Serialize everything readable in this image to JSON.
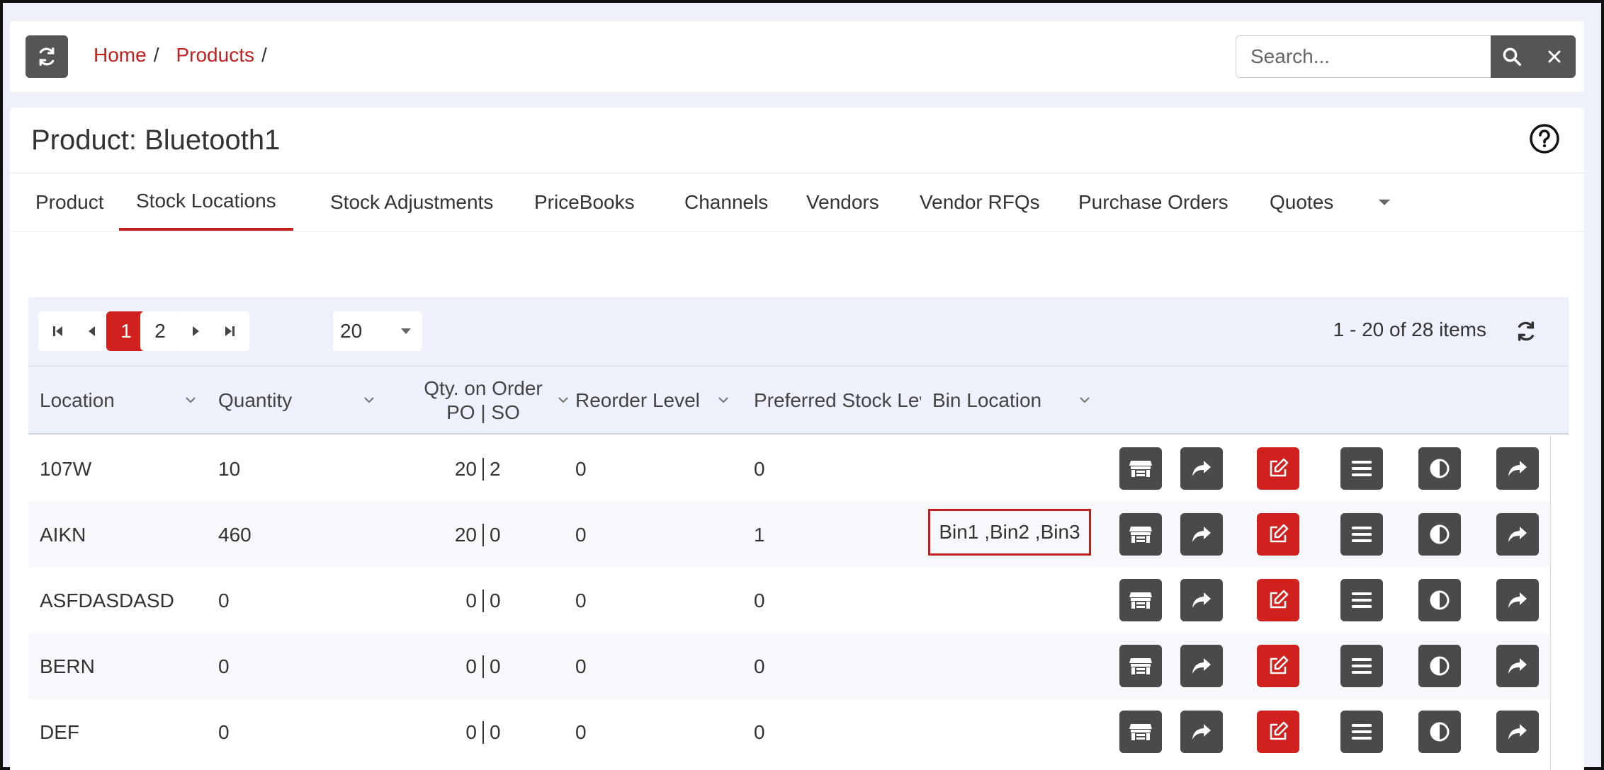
{
  "topbar": {
    "breadcrumb": [
      "Home",
      "Products"
    ],
    "separator": "/",
    "search_placeholder": "Search..."
  },
  "page": {
    "title": "Product: Bluetooth1"
  },
  "tabs": [
    {
      "label": "Product"
    },
    {
      "label": "Stock Locations",
      "active": true
    },
    {
      "label": "Stock Adjustments"
    },
    {
      "label": "PriceBooks"
    },
    {
      "label": "Channels"
    },
    {
      "label": "Vendors"
    },
    {
      "label": "Vendor RFQs"
    },
    {
      "label": "Purchase Orders"
    },
    {
      "label": "Quotes"
    }
  ],
  "pager": {
    "pages": [
      "1",
      "2"
    ],
    "current_page": "1",
    "page_size": "20",
    "info": "1 - 20 of 28 items"
  },
  "columns": {
    "location": "Location",
    "quantity": "Quantity",
    "qty_on_order_line1": "Qty. on Order",
    "qty_on_order_line2": "PO | SO",
    "reorder_level": "Reorder Level",
    "preferred_stock": "Preferred Stock Level",
    "bin_location": "Bin Location"
  },
  "rows": [
    {
      "location": "107W",
      "quantity": "10",
      "po": "20",
      "so": "2",
      "reorder": "0",
      "preferred": "0",
      "bin": ""
    },
    {
      "location": "AIKN",
      "quantity": "460",
      "po": "20",
      "so": "0",
      "reorder": "0",
      "preferred": "1",
      "bin": "Bin1 ,Bin2 ,Bin3"
    },
    {
      "location": "ASFDASDASD",
      "quantity": "0",
      "po": "0",
      "so": "0",
      "reorder": "0",
      "preferred": "0",
      "bin": ""
    },
    {
      "location": "BERN",
      "quantity": "0",
      "po": "0",
      "so": "0",
      "reorder": "0",
      "preferred": "0",
      "bin": ""
    },
    {
      "location": "DEF",
      "quantity": "0",
      "po": "0",
      "so": "0",
      "reorder": "0",
      "preferred": "0",
      "bin": ""
    }
  ],
  "icons": {
    "refresh": "refresh-icon",
    "search": "search-icon",
    "clear": "close-icon",
    "help": "help-circle-icon",
    "row_actions": [
      "warehouse-icon",
      "share-icon",
      "edit-icon",
      "menu-icon",
      "contrast-icon",
      "forward-icon"
    ]
  },
  "colors": {
    "accent": "#c0201e",
    "dark_button": "#4a4a4a",
    "header_bg": "#edf1fb"
  }
}
